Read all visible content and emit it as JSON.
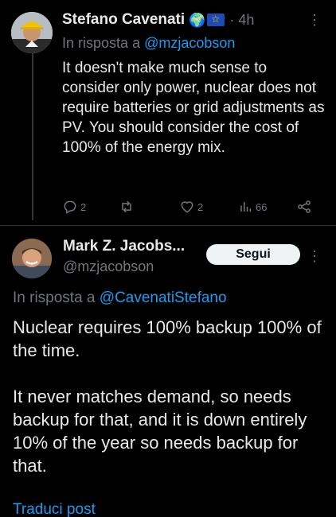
{
  "reply_tweet": {
    "author_name": "Stefano Cavenati",
    "badges": [
      "🌍",
      "eu-flag"
    ],
    "time": "· 4h",
    "replying_prefix": "In risposta a",
    "replying_handle": "@mzjacobson",
    "text": "It doesn't make much sense to consider only power, nuclear does not require batteries or grid adjustments as PV. You should consider the cost of 100% of the energy mix.",
    "actions": {
      "replies": "2",
      "likes": "2",
      "views": "66"
    }
  },
  "main_tweet": {
    "author_name": "Mark Z. Jacobs...",
    "handle": "@mzjacobson",
    "follow_label": "Segui",
    "replying_prefix": "In risposta a",
    "replying_handle": "@CavenatiStefano",
    "paragraph1": "Nuclear requires 100% backup 100% of the time.",
    "paragraph2": "It never matches demand, so needs backup for that, and it is down entirely 10% of the year so needs backup for that.",
    "truncated_link": "Traduci post"
  },
  "colors": {
    "background": "#000000",
    "text": "#e7e9ea",
    "muted": "#71767b",
    "link": "#1d9bf0",
    "divider": "#2f3336"
  }
}
